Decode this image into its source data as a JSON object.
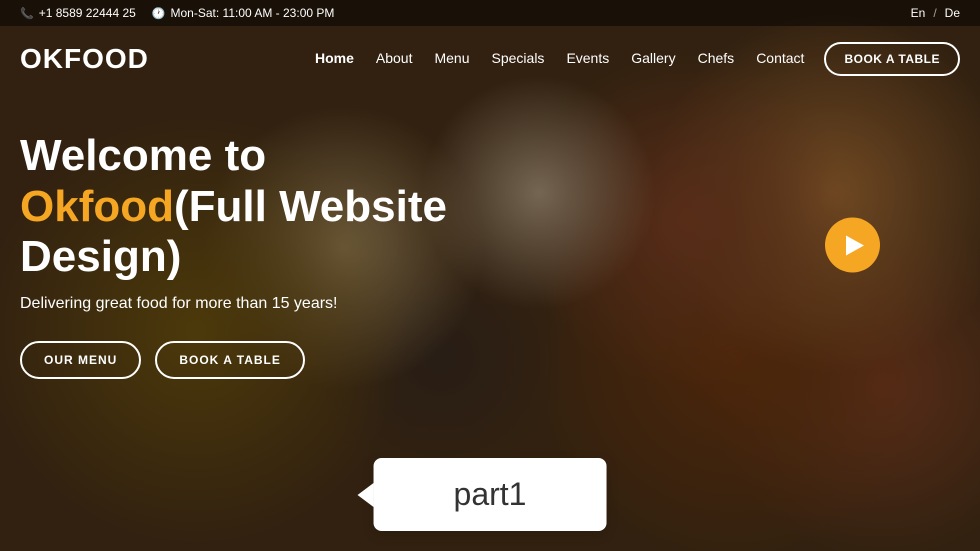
{
  "topbar": {
    "phone_icon": "📞",
    "phone": "+1 8589 22444 25",
    "clock_icon": "🕐",
    "hours": "Mon-Sat: 11:00 AM - 23:00 PM",
    "lang_current": "En",
    "lang_divider": "/",
    "lang_other": "De"
  },
  "navbar": {
    "logo": "OKFOOD",
    "links": [
      {
        "label": "Home",
        "active": true
      },
      {
        "label": "About",
        "active": false
      },
      {
        "label": "Menu",
        "active": false
      },
      {
        "label": "Specials",
        "active": false
      },
      {
        "label": "Events",
        "active": false
      },
      {
        "label": "Gallery",
        "active": false
      },
      {
        "label": "Chefs",
        "active": false
      },
      {
        "label": "Contact",
        "active": false
      }
    ],
    "book_btn": "BOOK A TABLE"
  },
  "hero": {
    "title_prefix": "Welcome to ",
    "title_brand": "Okfood",
    "title_suffix": "(Full Website Design)",
    "subtitle": "Delivering great food for more than 15 years!",
    "btn_menu": "OUR MENU",
    "btn_book": "BOOK A TABLE",
    "play_label": "Play video"
  },
  "part_label": {
    "text": "part1"
  },
  "colors": {
    "accent": "#f5a623",
    "white": "#ffffff",
    "dark_overlay": "rgba(0,0,0,0.45)"
  }
}
